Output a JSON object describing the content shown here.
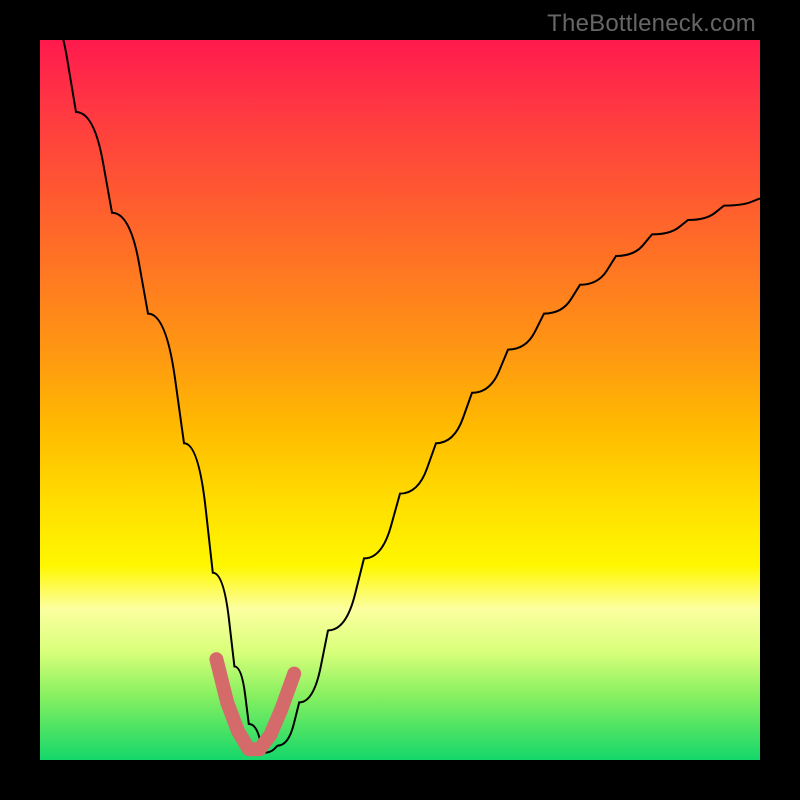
{
  "watermark": "TheBottleneck.com",
  "chart_data": {
    "type": "line",
    "title": "",
    "xlabel": "",
    "ylabel": "",
    "xlim": [
      0,
      100
    ],
    "ylim": [
      0,
      100
    ],
    "series": [
      {
        "name": "bottleneck-curve",
        "x": [
          0,
          5,
          10,
          15,
          20,
          24,
          27,
          29,
          31,
          33,
          36,
          40,
          45,
          50,
          55,
          60,
          65,
          70,
          75,
          80,
          85,
          90,
          95,
          100
        ],
        "y": [
          105,
          90,
          76,
          62,
          44,
          26,
          13,
          5,
          1,
          2,
          8,
          18,
          28,
          37,
          44,
          51,
          57,
          62,
          66,
          70,
          73,
          75,
          77,
          78
        ]
      },
      {
        "name": "highlight-valley",
        "x": [
          24.5,
          26,
          27.5,
          29,
          30.5,
          32,
          33.5,
          35.3
        ],
        "y": [
          14,
          8,
          4,
          1.5,
          1.5,
          3.5,
          7,
          12
        ]
      }
    ],
    "annotations": []
  },
  "colors": {
    "curve": "#000000",
    "highlight": "#d46a6a",
    "gradient_top": "#ff1a4d",
    "gradient_bottom": "#14d76a"
  }
}
